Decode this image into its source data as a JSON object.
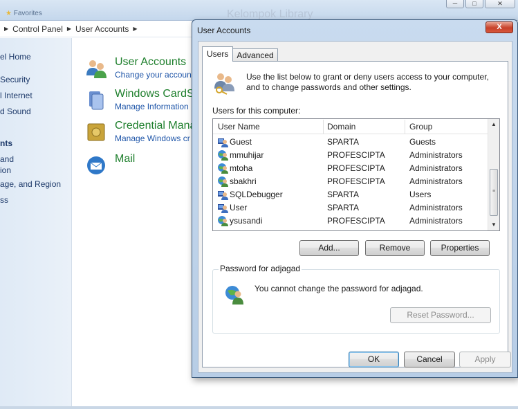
{
  "background": {
    "favorites_label": "Favorites",
    "search_hint": "Kelompok Library",
    "window_buttons": {
      "minimize": "─",
      "maximize": "□",
      "close": "✕"
    },
    "breadcrumb": [
      "Control Panel",
      "User Accounts"
    ],
    "left_nav": [
      "el Home",
      "Security",
      "l Internet",
      "d Sound",
      "nts",
      "and",
      "ion",
      "age, and Region",
      "ss"
    ],
    "categories": [
      {
        "title": "User Accounts",
        "subtitle": "Change your accoun",
        "icon": "users-icon"
      },
      {
        "title": "Windows CardS",
        "subtitle": "Manage Information",
        "icon": "cardspace-icon"
      },
      {
        "title": "Credential Mana",
        "subtitle": "Manage Windows cr",
        "icon": "vault-icon"
      },
      {
        "title": "Mail",
        "subtitle": "",
        "icon": "mail-icon"
      }
    ]
  },
  "dialog": {
    "title": "User Accounts",
    "close_label": "X",
    "tabs": [
      {
        "label": "Users",
        "active": true
      },
      {
        "label": "Advanced",
        "active": false
      }
    ],
    "intro_text": "Use the list below to grant or deny users access to your computer, and to change passwords and other settings.",
    "users_label": "Users for this computer:",
    "columns": [
      "User Name",
      "Domain",
      "Group"
    ],
    "users": [
      {
        "name": "Guest",
        "domain": "SPARTA",
        "group": "Guests",
        "icon": "local-user-icon"
      },
      {
        "name": "mmuhijar",
        "domain": "PROFESCIPTA",
        "group": "Administrators",
        "icon": "domain-user-icon"
      },
      {
        "name": "mtoha",
        "domain": "PROFESCIPTA",
        "group": "Administrators",
        "icon": "domain-user-icon"
      },
      {
        "name": "sbakhri",
        "domain": "PROFESCIPTA",
        "group": "Administrators",
        "icon": "domain-user-icon"
      },
      {
        "name": "SQLDebugger",
        "domain": "SPARTA",
        "group": "Users",
        "icon": "local-user-icon"
      },
      {
        "name": "User",
        "domain": "SPARTA",
        "group": "Administrators",
        "icon": "local-user-icon"
      },
      {
        "name": "ysusandi",
        "domain": "PROFESCIPTA",
        "group": "Administrators",
        "icon": "domain-user-icon"
      }
    ],
    "buttons": {
      "add": "Add...",
      "remove": "Remove",
      "properties": "Properties"
    },
    "password_group": {
      "legend": "Password for adjagad",
      "message": "You cannot change the password for adjagad.",
      "reset_button": "Reset Password..."
    },
    "footer": {
      "ok": "OK",
      "cancel": "Cancel",
      "apply": "Apply"
    }
  }
}
